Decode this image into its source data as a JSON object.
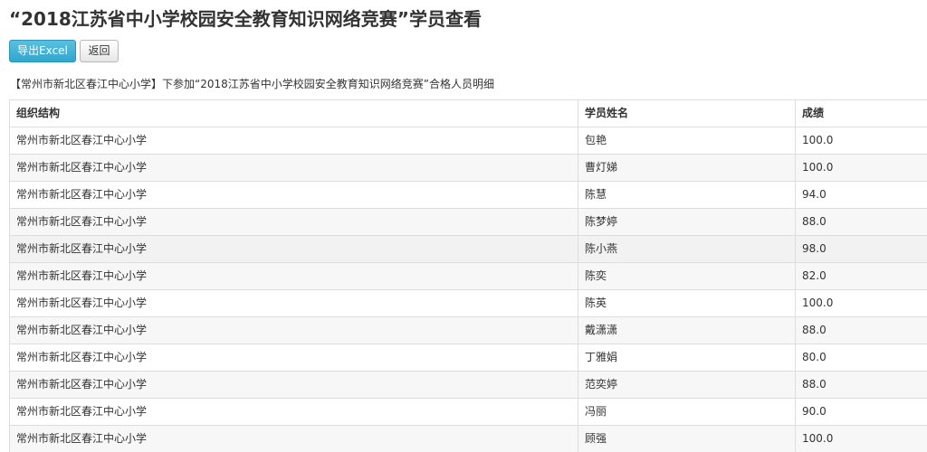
{
  "page": {
    "title": "“2018江苏省中小学校园安全教育知识网络竞赛”学员查看",
    "summary": "【常州市新北区春江中心小学】下参加“2018江苏省中小学校园安全教育知识网络竞赛”合格人员明细"
  },
  "toolbar": {
    "export_label": "导出Excel",
    "back_label": "返回"
  },
  "colors": {
    "export_button": "#31a6cd",
    "row_stripe": "#f7f7f7",
    "border": "#dddddd"
  },
  "table": {
    "columns": [
      "组织结构",
      "学员姓名",
      "成绩"
    ],
    "rows": [
      [
        "常州市新北区春江中心小学",
        "包艳",
        "100.0"
      ],
      [
        "常州市新北区春江中心小学",
        "曹灯娣",
        "100.0"
      ],
      [
        "常州市新北区春江中心小学",
        "陈慧",
        "94.0"
      ],
      [
        "常州市新北区春江中心小学",
        "陈梦婷",
        "88.0"
      ],
      [
        "常州市新北区春江中心小学",
        "陈小燕",
        "98.0"
      ],
      [
        "常州市新北区春江中心小学",
        "陈奕",
        "82.0"
      ],
      [
        "常州市新北区春江中心小学",
        "陈英",
        "100.0"
      ],
      [
        "常州市新北区春江中心小学",
        "戴潇潇",
        "88.0"
      ],
      [
        "常州市新北区春江中心小学",
        "丁雅娟",
        "80.0"
      ],
      [
        "常州市新北区春江中心小学",
        "范奕婷",
        "88.0"
      ],
      [
        "常州市新北区春江中心小学",
        "冯丽",
        "90.0"
      ],
      [
        "常州市新北区春江中心小学",
        "顾强",
        "100.0"
      ]
    ]
  }
}
